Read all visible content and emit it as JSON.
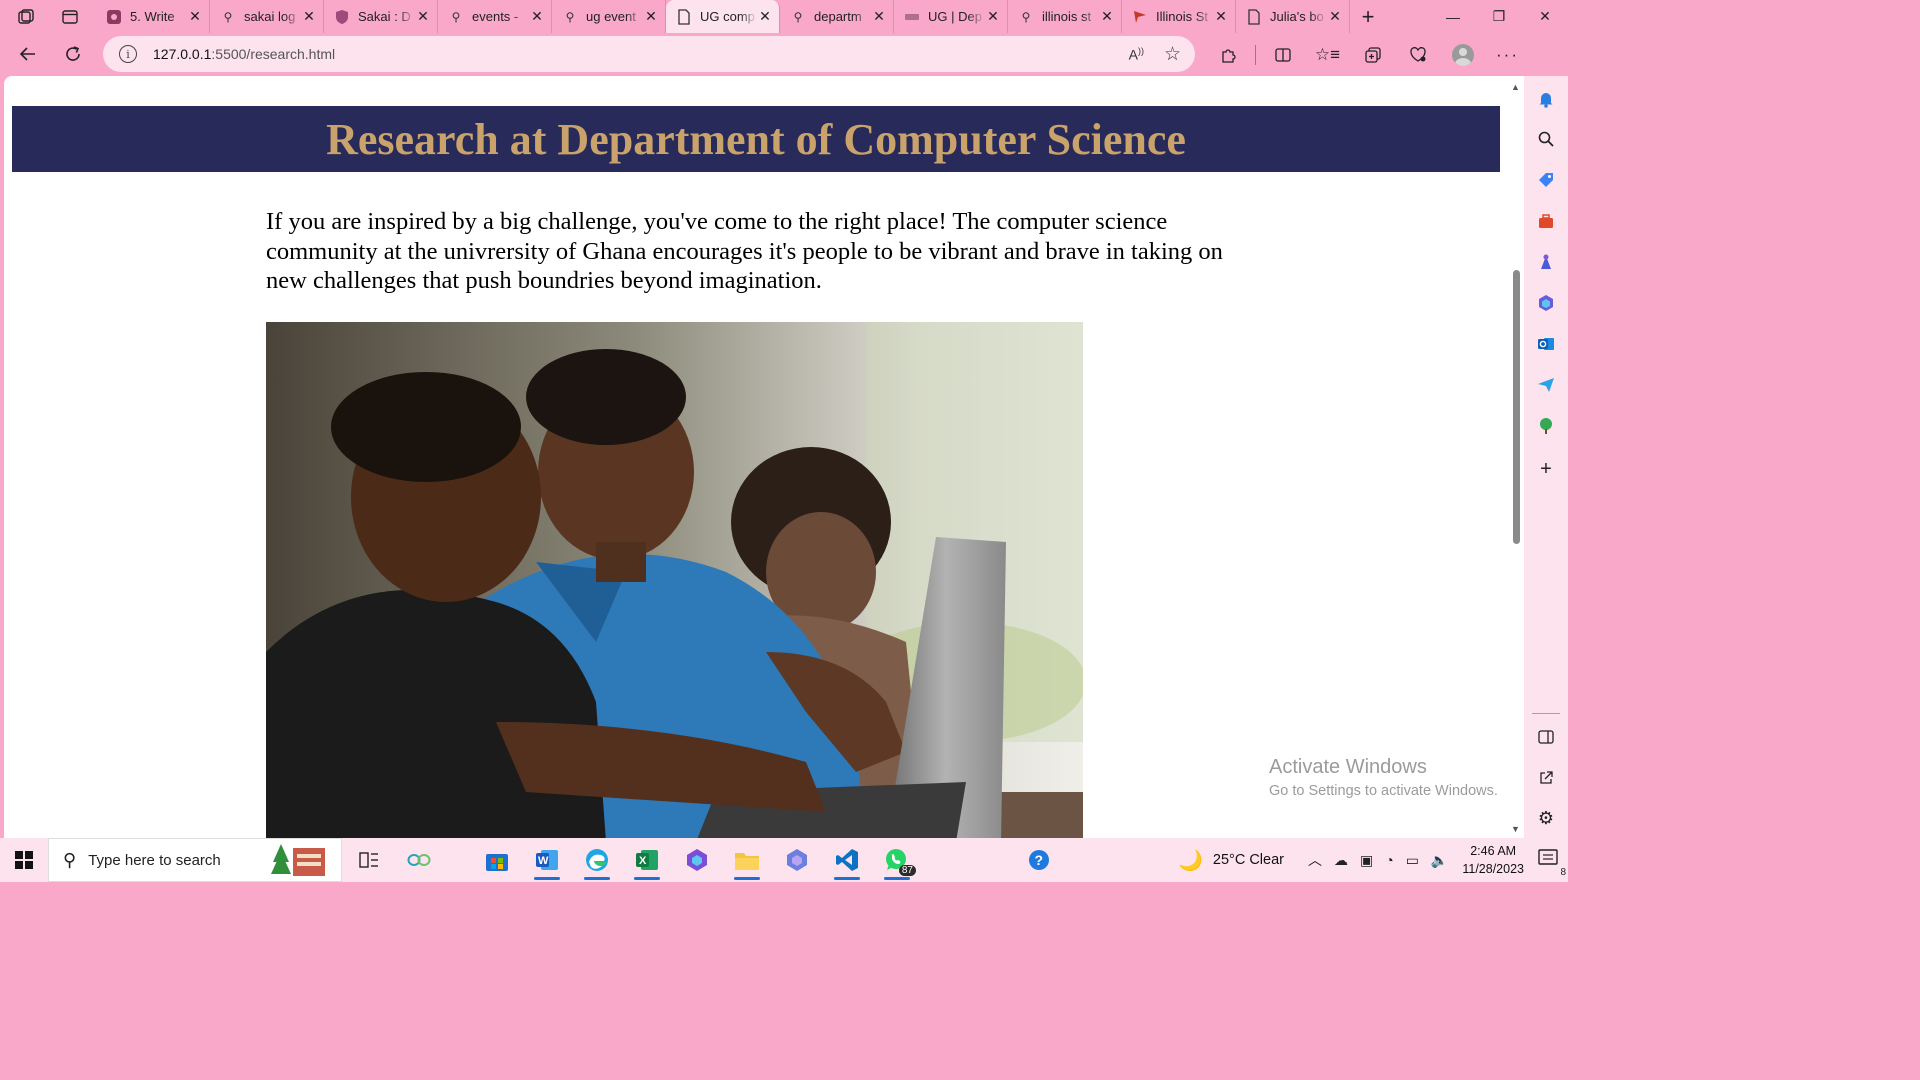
{
  "browser": {
    "tabs": [
      {
        "title": "5. Write",
        "icon": "app-icon"
      },
      {
        "title": "sakai log",
        "icon": "search-icon"
      },
      {
        "title": "Sakai : D",
        "icon": "shield-icon"
      },
      {
        "title": "events -",
        "icon": "search-icon"
      },
      {
        "title": "ug event",
        "icon": "search-icon"
      },
      {
        "title": "UG comp",
        "icon": "document-icon",
        "active": true
      },
      {
        "title": "departm",
        "icon": "search-icon"
      },
      {
        "title": "UG | Dep",
        "icon": "site-icon"
      },
      {
        "title": "illinois st",
        "icon": "search-icon"
      },
      {
        "title": "Illinois St",
        "icon": "site-icon"
      },
      {
        "title": "Julia's bo",
        "icon": "document-icon"
      }
    ],
    "url_host": "127.0.0.1",
    "url_path": ":5500/research.html"
  },
  "page": {
    "title": "Research at Department of Computer Science",
    "intro": "If you are inspired by a big challenge, you've come to the right place! The computer science community at the univrersity of Ghana encourages it's people to be vibrant and brave in taking on new challenges that push boundries beyond imagination.",
    "colors": {
      "header_bg": "#282a5a",
      "title": "#c9a36b"
    }
  },
  "watermark": {
    "title": "Activate Windows",
    "subtitle": "Go to Settings to activate Windows."
  },
  "taskbar": {
    "search_placeholder": "Type here to search",
    "whatsapp_badge": "87",
    "weather": "25°C  Clear",
    "time": "2:46 AM",
    "date": "11/28/2023",
    "notification_count": "8"
  }
}
